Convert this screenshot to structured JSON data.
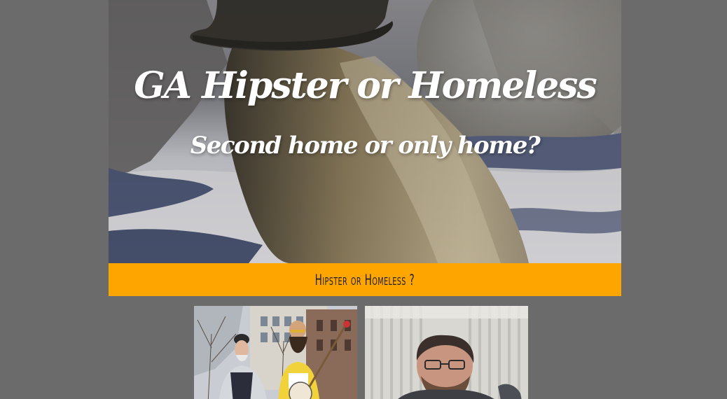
{
  "hero": {
    "title": "GA Hipster or Homeless",
    "subtitle": "Second home or only home?"
  },
  "banner": {
    "label": "Hipster or Homeless ?"
  },
  "cards": [
    {
      "image": "two-bearded-men-street-photo"
    },
    {
      "image": "man-with-glasses-selfie-photo"
    }
  ],
  "colors": {
    "page_background": "#6b6b6b",
    "banner_background": "#ffa500",
    "hero_text": "#ffffff",
    "banner_text": "#222222"
  }
}
